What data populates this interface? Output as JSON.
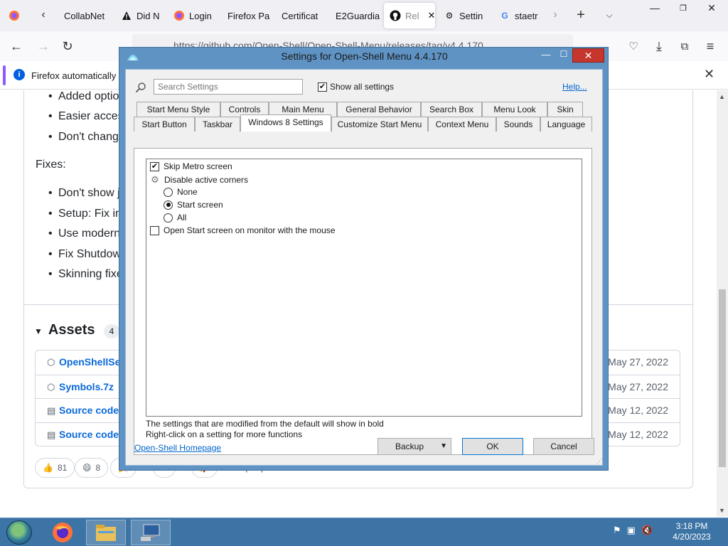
{
  "browser": {
    "tabs": [
      {
        "label": "",
        "icon": "firefox-icon"
      },
      {
        "label": "CollabNet",
        "icon": "collabnet-icon"
      },
      {
        "label": "Did N",
        "icon": "warning-icon"
      },
      {
        "label": "Login",
        "icon": "firefox-icon"
      },
      {
        "label": "Firefox Pa",
        "icon": "none"
      },
      {
        "label": "Certificat",
        "icon": "none"
      },
      {
        "label": "E2Guardia",
        "icon": "none"
      },
      {
        "label": "Rel",
        "icon": "github-icon",
        "active": true
      },
      {
        "label": "Settin",
        "icon": "gear-icon"
      },
      {
        "label": "staetr",
        "icon": "google-icon"
      }
    ],
    "url": "https://github.com/Open-Shell/Open-Shell-Menu/releases/tag/v4.4.170",
    "infobar_text": "Firefox automatically se"
  },
  "page": {
    "bullets_top": [
      "Added optio",
      "Easier access",
      "Don't change"
    ],
    "fixes_label": "Fixes:",
    "bullets_fixes": [
      "Don't show j",
      "Setup: Fix ins",
      "Use modern",
      "Fix Shutdow",
      "Skinning fixe"
    ],
    "assets_title": "Assets",
    "assets_count": "4",
    "assets": [
      {
        "name": "OpenShellSet",
        "date": "May 27, 2022",
        "icon": "package-icon"
      },
      {
        "name": "Symbols.7z",
        "date": "May 27, 2022",
        "icon": "package-icon"
      },
      {
        "name": "Source code (",
        "date": "May 12, 2022",
        "icon": "zip-icon"
      },
      {
        "name": "Source code (",
        "date": "May 12, 2022",
        "icon": "zip-icon"
      }
    ],
    "reactions": [
      {
        "emoji": "👍",
        "count": "81"
      },
      {
        "emoji": "😄",
        "count": "8"
      },
      {
        "emoji": "🎉",
        "count": ""
      },
      {
        "emoji": "❤",
        "count": ""
      },
      {
        "emoji": "🚀",
        "count": ""
      }
    ],
    "reacted_text": "116 people reacted"
  },
  "dialog": {
    "title": "Settings for Open-Shell Menu 4.4.170",
    "search_placeholder": "Search Settings",
    "show_all_label": "Show all settings",
    "show_all_checked": true,
    "help_label": "Help...",
    "tabs_row1": [
      "Start Menu Style",
      "Controls",
      "Main Menu",
      "General Behavior",
      "Search Box",
      "Menu Look",
      "Skin"
    ],
    "tabs_row2": [
      "Start Button",
      "Taskbar",
      "Windows 8 Settings",
      "Customize Start Menu",
      "Context Menu",
      "Sounds",
      "Language"
    ],
    "active_tab": "Windows 8 Settings",
    "settings": {
      "skip_metro": {
        "label": "Skip Metro screen",
        "checked": true
      },
      "disable_corners": {
        "label": "Disable active corners"
      },
      "corner_options": [
        {
          "label": "None",
          "selected": false
        },
        {
          "label": "Start screen",
          "selected": true
        },
        {
          "label": "All",
          "selected": false
        }
      ],
      "open_start_monitor": {
        "label": "Open Start screen on monitor with the mouse",
        "checked": false
      }
    },
    "note_bold": "The settings that are modified from the default will show in bold",
    "note_rightclick": "Right-click on a setting for more functions",
    "homepage_link": "Open-Shell Homepage",
    "backup_label": "Backup",
    "ok_label": "OK",
    "cancel_label": "Cancel"
  },
  "taskbar": {
    "apps": [
      "firefox-icon",
      "file-explorer-icon",
      "control-panel-icon"
    ],
    "time": "3:18 PM",
    "date": "4/20/2023"
  }
}
